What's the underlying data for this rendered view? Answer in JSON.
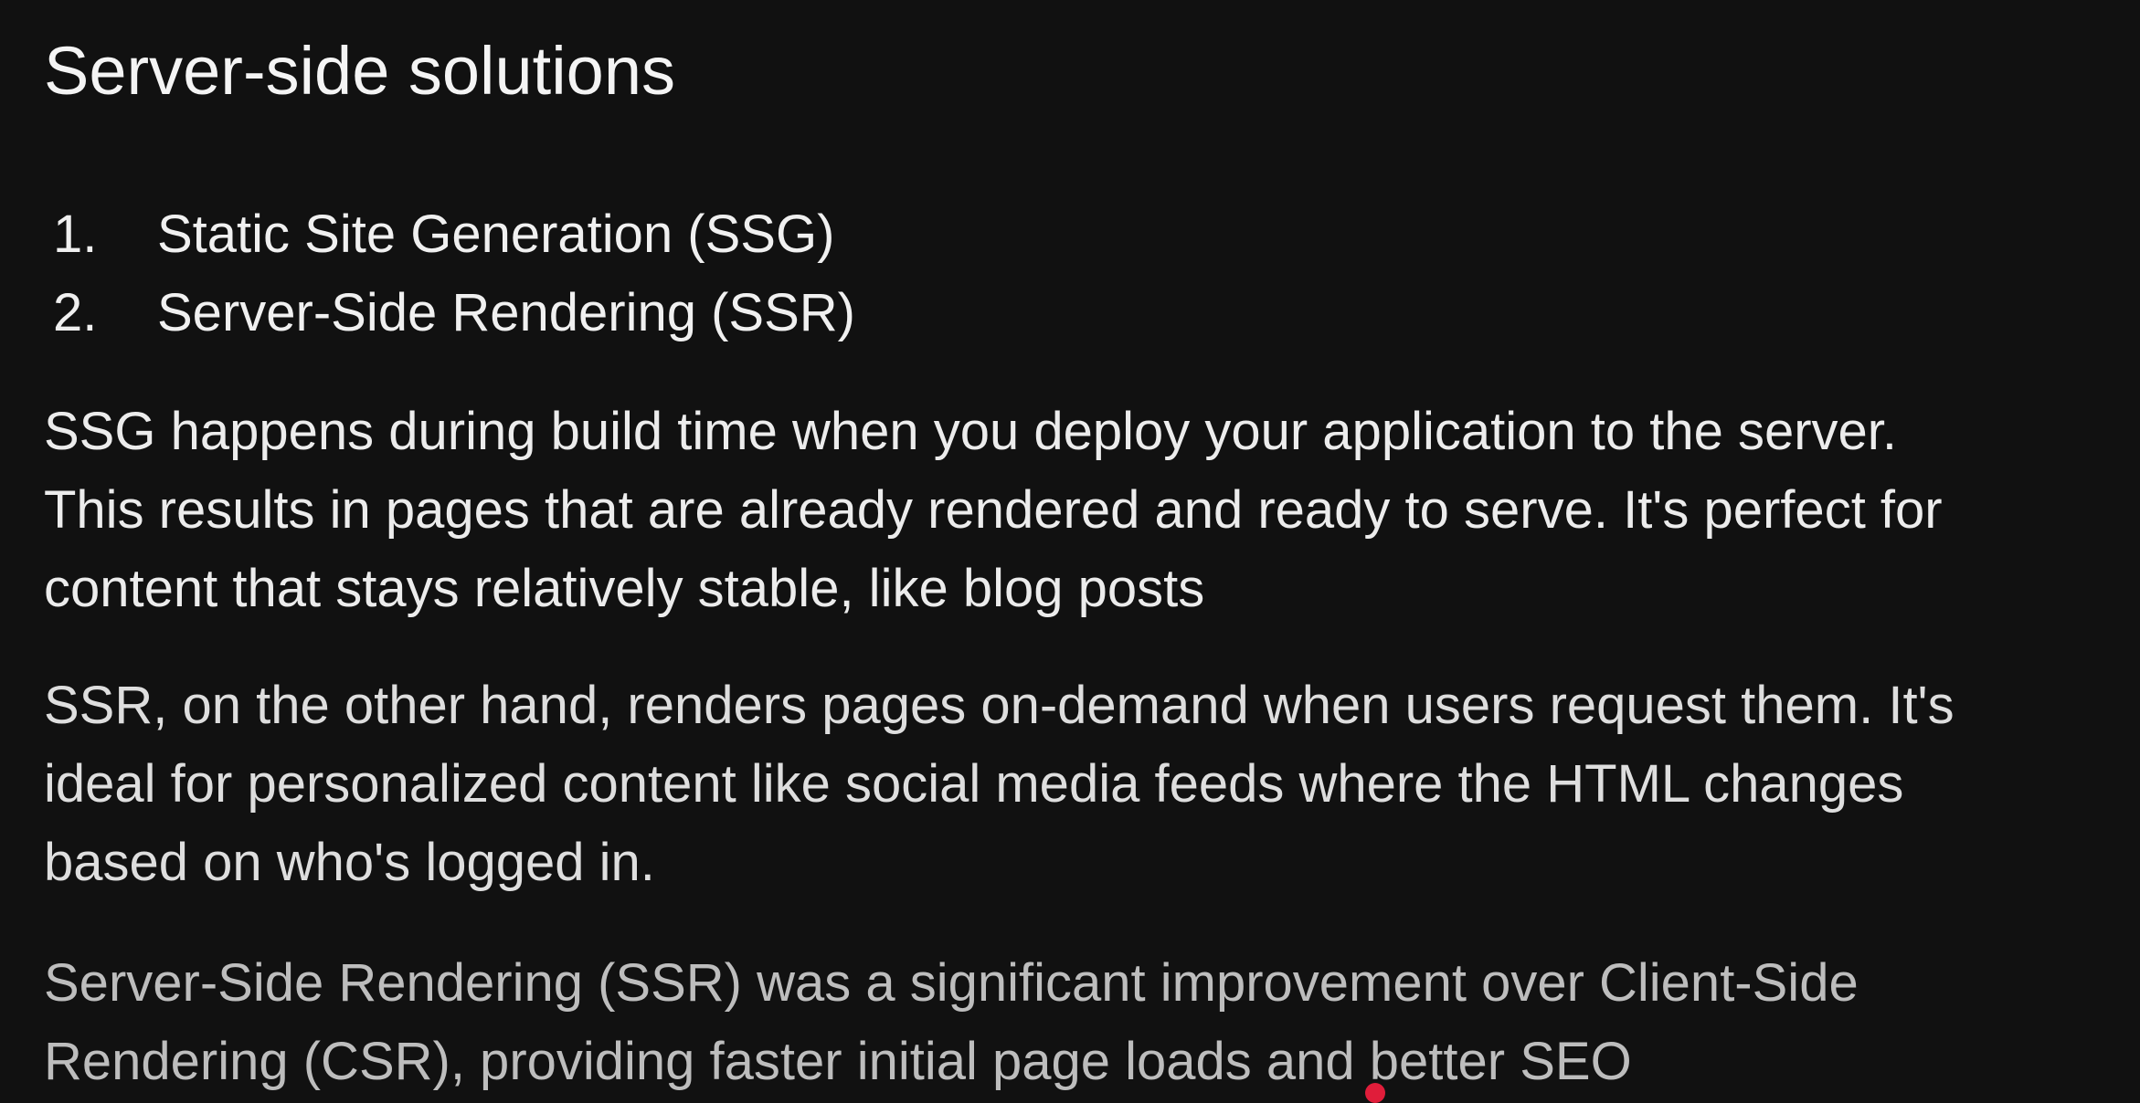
{
  "slide": {
    "title": "Server-side solutions",
    "list": [
      {
        "number": "1.",
        "text": "Static Site Generation (SSG)"
      },
      {
        "number": "2.",
        "text": "Server-Side Rendering (SSR)"
      }
    ],
    "paragraphs": [
      {
        "lines": [
          "SSG happens during build time when you deploy your application to the server.",
          "This results in pages that are already rendered and ready to serve. It's perfect for",
          "content that stays relatively stable, like blog posts"
        ]
      },
      {
        "lines": [
          "SSR, on the other hand, renders pages on-demand when users request them. It's",
          "ideal for personalized content like social media feeds where the HTML changes",
          "based on who's logged in."
        ]
      },
      {
        "lines": [
          "Server-Side Rendering (SSR) was a significant improvement over Client-Side",
          "Rendering (CSR), providing faster initial page loads and better SEO"
        ]
      }
    ]
  },
  "colors": {
    "background": "#111111",
    "text": "#f0f0f0",
    "cursor": "#e01d3a"
  }
}
